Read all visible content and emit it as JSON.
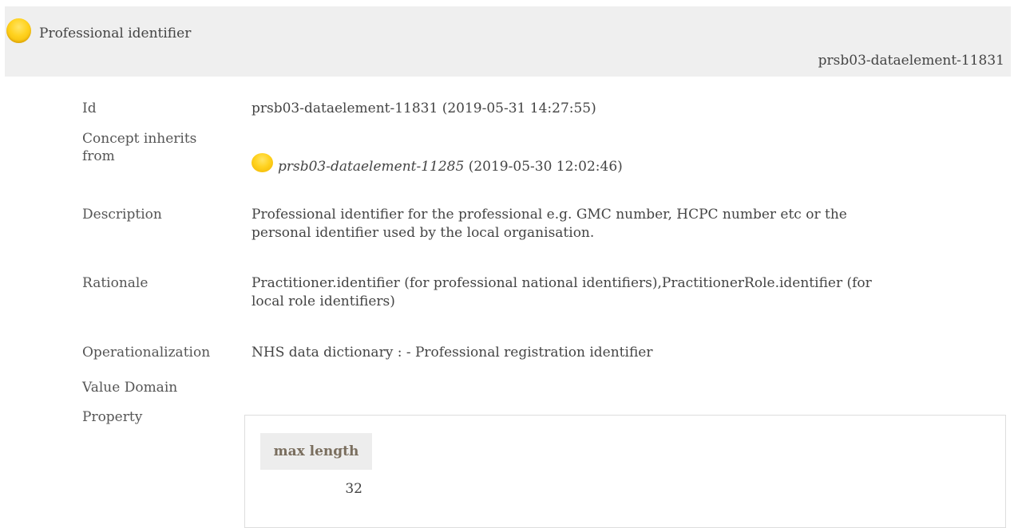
{
  "header": {
    "title": "Professional identifier",
    "id": "prsb03-dataelement-11831",
    "status_icon": "status-draft-icon",
    "status_color": "#ffd21f",
    "background": "#efefef"
  },
  "fields": {
    "id": {
      "label": "Id",
      "value": "prsb03-dataelement-11831 (2019-05-31 14:27:55)"
    },
    "inherits": {
      "label_line1": "Concept inherits",
      "label_line2": "from",
      "ref": "prsb03-dataelement-11285",
      "date": " (2019-05-30 12:02:46)"
    },
    "description": {
      "label": "Description",
      "line1": "Professional identifier for the professional e.g. GMC number, HCPC number etc or the",
      "line2": "personal identifier used by the local organisation."
    },
    "rationale": {
      "label": "Rationale",
      "line1": "Practitioner.identifier (for professional national identifiers),PractitionerRole.identifier (for",
      "line2": "local role identifiers)"
    },
    "operationalization": {
      "label": "Operationalization",
      "value": "NHS data dictionary : - Professional registration identifier"
    },
    "value_domain": {
      "label": "Value Domain"
    },
    "property": {
      "label": "Property",
      "header": "max length",
      "value": "32"
    }
  }
}
